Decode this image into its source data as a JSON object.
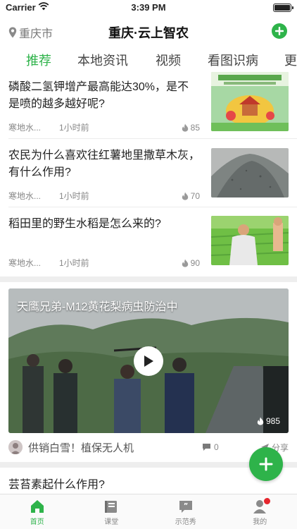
{
  "status_bar": {
    "carrier": "Carrier",
    "time": "3:39 PM"
  },
  "header": {
    "location": "重庆市",
    "title": "重庆·云上智农"
  },
  "tabs": [
    {
      "label": "推荐",
      "active": true
    },
    {
      "label": "本地资讯",
      "active": false
    },
    {
      "label": "视频",
      "active": false
    },
    {
      "label": "看图识病",
      "active": false
    },
    {
      "label": "更",
      "active": false
    }
  ],
  "articles": [
    {
      "title": "磷酸二氢钾增产最高能达30%，是不是喷的越多越好呢?",
      "source": "寒地水...",
      "time": "1小时前",
      "views": "85",
      "thumb_icon": "fertilizer-bag-image"
    },
    {
      "title": "农民为什么喜欢往红薯地里撒草木灰，有什么作用?",
      "source": "寒地水...",
      "time": "1小时前",
      "views": "70",
      "thumb_icon": "ash-pile-image"
    },
    {
      "title": "稻田里的野生水稻是怎么来的?",
      "source": "寒地水...",
      "time": "1小时前",
      "views": "90",
      "thumb_icon": "rice-field-image"
    }
  ],
  "video": {
    "title": "天鹰兄弟-M12黄花梨病虫防治中",
    "views": "985",
    "author": "供销白雪！植保无人机",
    "comments": "0",
    "share_label": "分享"
  },
  "next_article": {
    "title": "芸苔素起什么作用?"
  },
  "tab_bar": [
    {
      "label": "首页",
      "icon": "home-icon",
      "active": true
    },
    {
      "label": "课堂",
      "icon": "book-icon",
      "active": false
    },
    {
      "label": "示范秀",
      "icon": "quote-bubble-icon",
      "active": false
    },
    {
      "label": "我的",
      "icon": "profile-icon",
      "active": false,
      "badge": true
    }
  ],
  "colors": {
    "accent": "#2eb34a",
    "badge": "#e6262e",
    "divider": "#eeeeee"
  }
}
